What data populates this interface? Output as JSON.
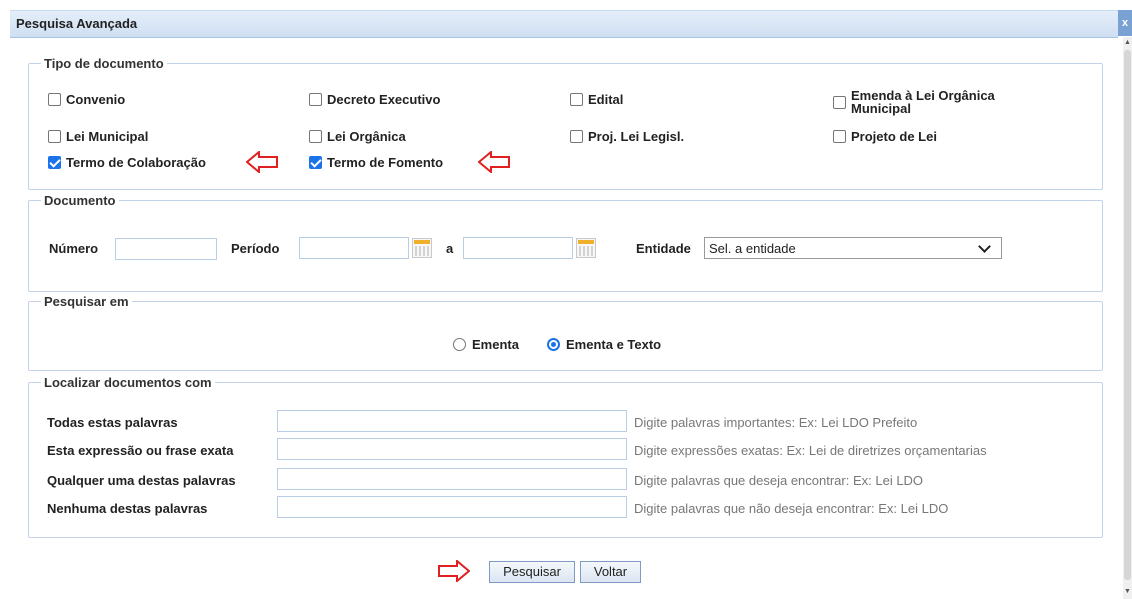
{
  "window": {
    "title": "Pesquisa Avançada",
    "close_glyph": "x"
  },
  "tipo_documento": {
    "legend": "Tipo de documento",
    "items": [
      {
        "label": "Convenio",
        "checked": false
      },
      {
        "label": "Decreto Executivo",
        "checked": false
      },
      {
        "label": "Edital",
        "checked": false
      },
      {
        "label": "Emenda à Lei Orgânica Municipal",
        "checked": false
      },
      {
        "label": "Lei Municipal",
        "checked": false
      },
      {
        "label": "Lei Orgânica",
        "checked": false
      },
      {
        "label": "Proj. Lei Legisl.",
        "checked": false
      },
      {
        "label": "Projeto de Lei",
        "checked": false
      },
      {
        "label": "Termo de Colaboração",
        "checked": true
      },
      {
        "label": "Termo de Fomento",
        "checked": true
      }
    ]
  },
  "documento": {
    "legend": "Documento",
    "numero_label": "Número",
    "numero_value": "",
    "periodo_label": "Período",
    "periodo_inicio": "",
    "periodo_sep": "a",
    "periodo_fim": "",
    "entidade_label": "Entidade",
    "entidade_selected": "Sel. a entidade"
  },
  "pesquisar_em": {
    "legend": "Pesquisar em",
    "options": [
      {
        "label": "Ementa",
        "selected": false
      },
      {
        "label": "Ementa e Texto",
        "selected": true
      }
    ]
  },
  "localizar": {
    "legend": "Localizar documentos com",
    "rows": [
      {
        "label": "Todas estas palavras",
        "value": "",
        "hint": "Digite palavras importantes: Ex: Lei LDO Prefeito"
      },
      {
        "label": "Esta expressão ou frase exata",
        "value": "",
        "hint": "Digite expressões exatas: Ex: Lei de diretrizes orçamentarias"
      },
      {
        "label": "Qualquer uma destas palavras",
        "value": "",
        "hint": "Digite palavras que deseja encontrar: Ex: Lei LDO"
      },
      {
        "label": "Nenhuma destas palavras",
        "value": "",
        "hint": "Digite palavras que não deseja encontrar: Ex: Lei LDO"
      }
    ]
  },
  "buttons": {
    "pesquisar": "Pesquisar",
    "voltar": "Voltar"
  },
  "colors": {
    "accent": "#1a73e8",
    "annotation_arrow": "#e02020",
    "title_bar": "#d6e4f5"
  }
}
